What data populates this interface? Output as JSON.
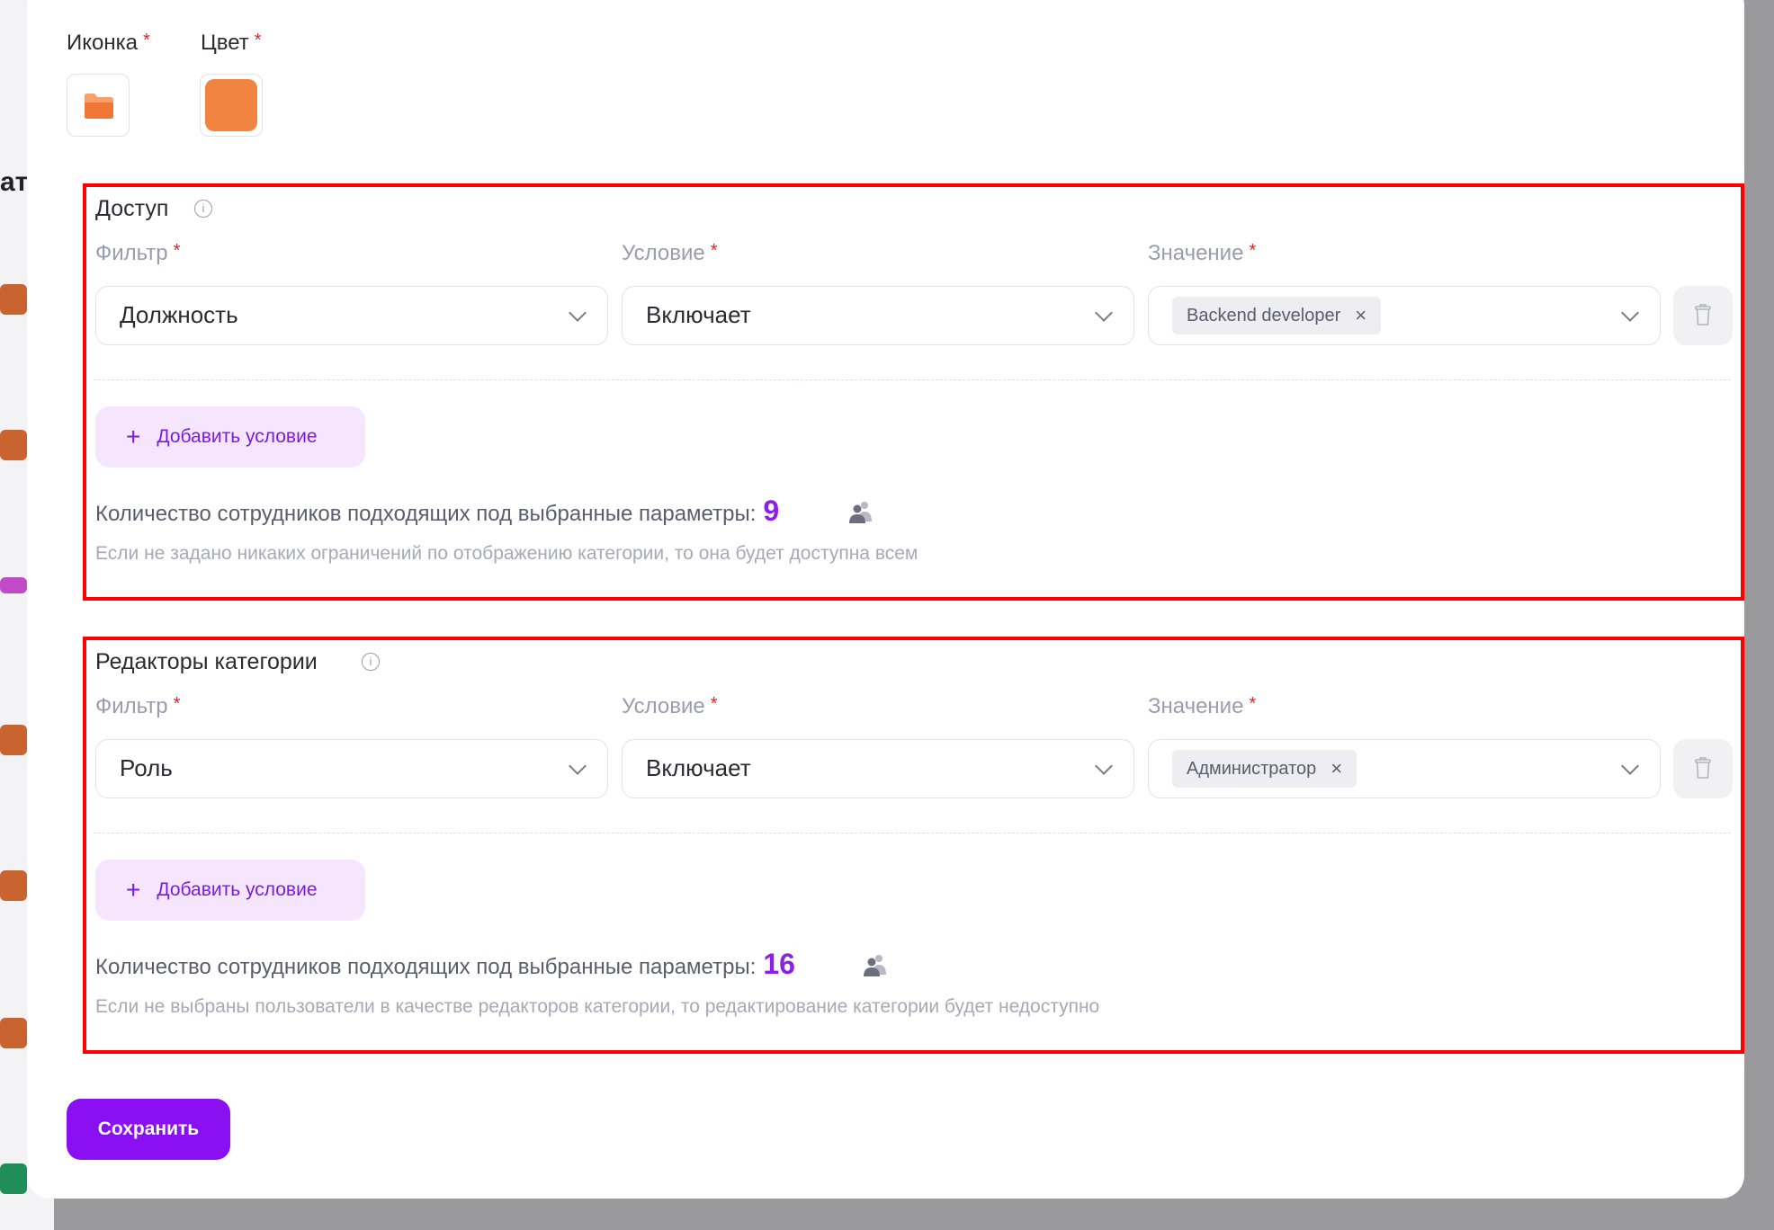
{
  "icon_color": {
    "icon_label": "Иконка",
    "color_label": "Цвет",
    "required_mark": "*",
    "selected_color": "#f28441"
  },
  "access": {
    "title": "Доступ",
    "filter_label": "Фильтр",
    "condition_label": "Условие",
    "value_label": "Значение",
    "filter_value": "Должность",
    "condition_value": "Включает",
    "value_chip": "Backend developer",
    "chip_remove": "×",
    "add_condition": "Добавить условие",
    "count_text": "Количество сотрудников подходящих под выбранные параметры:",
    "count_value": "9",
    "hint": "Если не задано никаких ограничений по отображению категории, то она будет доступна всем"
  },
  "editors": {
    "title": "Редакторы категории",
    "filter_label": "Фильтр",
    "condition_label": "Условие",
    "value_label": "Значение",
    "filter_value": "Роль",
    "condition_value": "Включает",
    "value_chip": "Администратор",
    "chip_remove": "×",
    "add_condition": "Добавить условие",
    "count_text": "Количество сотрудников подходящих под выбранные параметры:",
    "count_value": "16",
    "hint": "Если не выбраны пользователи в качестве редакторов категории, то редактирование категории будет недоступно"
  },
  "save_label": "Сохранить",
  "background": {
    "edge_text": "ат"
  },
  "colors": {
    "accent": "#8a10f2",
    "highlight_border": "#ff0000",
    "required": "#e0252c"
  }
}
